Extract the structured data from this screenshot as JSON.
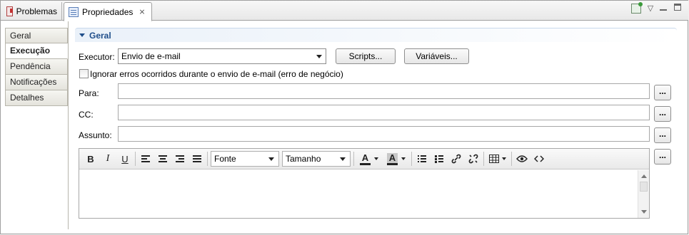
{
  "tabs": [
    {
      "label": "Problemas",
      "icon": "problems-icon"
    },
    {
      "label": "Propriedades",
      "icon": "properties-icon",
      "close": "⨯"
    }
  ],
  "nav": {
    "items": [
      "Geral",
      "Execução",
      "Pendência",
      "Notificações",
      "Detalhes"
    ],
    "active": "Execução"
  },
  "section": {
    "title": "Geral"
  },
  "form": {
    "executor_label": "Executor:",
    "executor_value": "Envio de e-mail",
    "scripts_label": "Scripts...",
    "variaveis_label": "Variáveis...",
    "ignore_label": "Ignorar erros ocorridos durante o envio de e-mail (erro de negócio)",
    "ignore_checked": false,
    "para_label": "Para:",
    "cc_label": "CC:",
    "assunto_label": "Assunto:",
    "browse_label": "..."
  },
  "editor": {
    "bold": "B",
    "italic": "I",
    "underline": "U",
    "font_label": "Fonte",
    "size_label": "Tamanho",
    "fore_color": "A",
    "back_color": "A"
  },
  "colors": {
    "section_title": "#1f4e8a",
    "active_tab_bg": "#ffffff"
  }
}
